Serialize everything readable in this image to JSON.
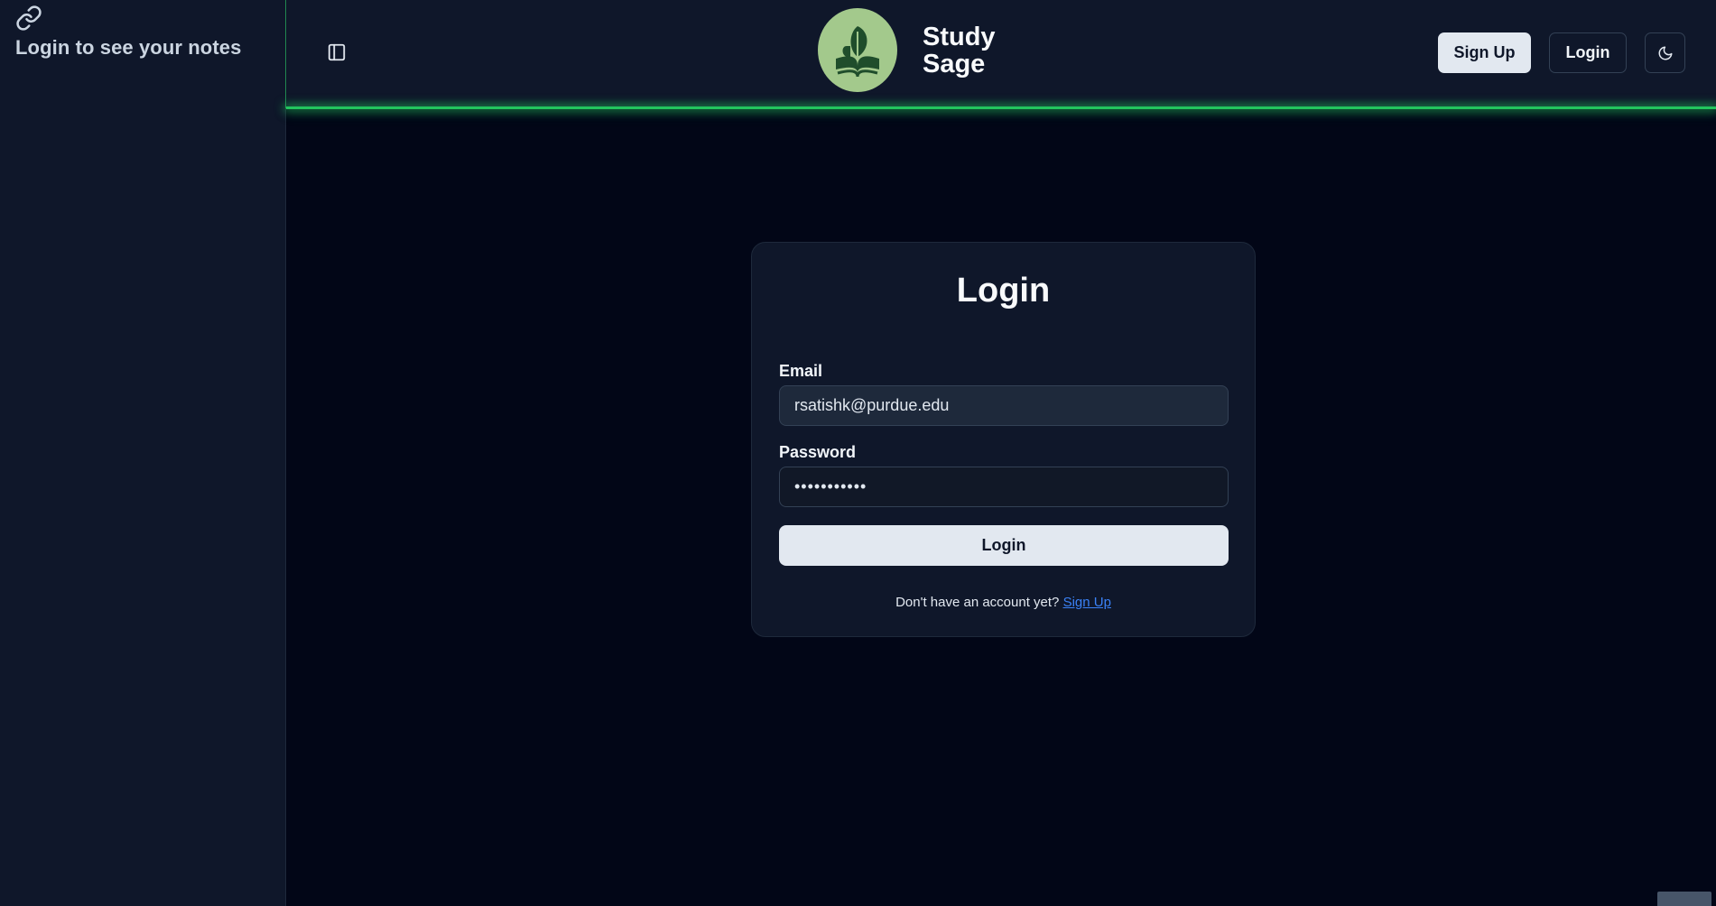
{
  "sidebar": {
    "icon": "link-icon",
    "message": "Login to see your notes"
  },
  "header": {
    "toggle_icon": "sidebar-toggle-icon",
    "brand": {
      "logo_icon": "book-leaf-logo",
      "line1": "Study",
      "line2": "Sage"
    },
    "signup_label": "Sign Up",
    "login_label": "Login",
    "theme_icon": "moon-icon",
    "accent_color": "#22c55e"
  },
  "login_form": {
    "title": "Login",
    "email_label": "Email",
    "email_value": "rsatishk@purdue.edu",
    "password_label": "Password",
    "password_value": "•••••••••••",
    "submit_label": "Login",
    "footer_prefix": "Don't have an account yet? ",
    "footer_link": "Sign Up"
  },
  "colors": {
    "background": "#020617",
    "panel": "#0f172a",
    "link": "#3b82f6",
    "primary_button": "#e2e8f0"
  }
}
